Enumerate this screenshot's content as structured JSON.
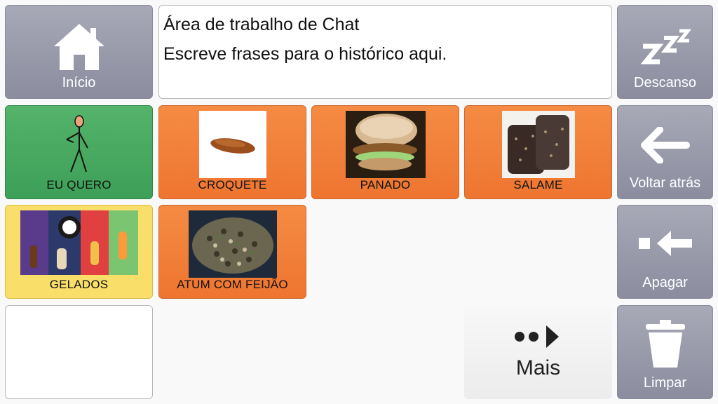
{
  "chat": {
    "lines": [
      "Área de trabalho de Chat",
      "Escreve frases para o histórico aqui."
    ]
  },
  "nav": {
    "home": "Início",
    "rest": "Descanso",
    "back": "Voltar atrás",
    "delete": "Apagar",
    "clear": "Limpar",
    "more": "Mais"
  },
  "symbols": [
    {
      "label": "EU QUERO",
      "color": "#4aaa62"
    },
    {
      "label": "CROQUETE",
      "color": "#f2803a"
    },
    {
      "label": "PANADO",
      "color": "#f2803a"
    },
    {
      "label": "SALAME",
      "color": "#f2803a"
    },
    {
      "label": "GELADOS",
      "color": "#f9df6a"
    },
    {
      "label": "ATUM COM FEIJÃO",
      "color": "#f2803a"
    }
  ],
  "icons": {
    "home": "home-icon",
    "rest": "sleep-zzz-icon",
    "back": "arrow-left-icon",
    "delete": "backspace-icon",
    "clear": "trash-icon",
    "more": "more-arrow-icon"
  }
}
